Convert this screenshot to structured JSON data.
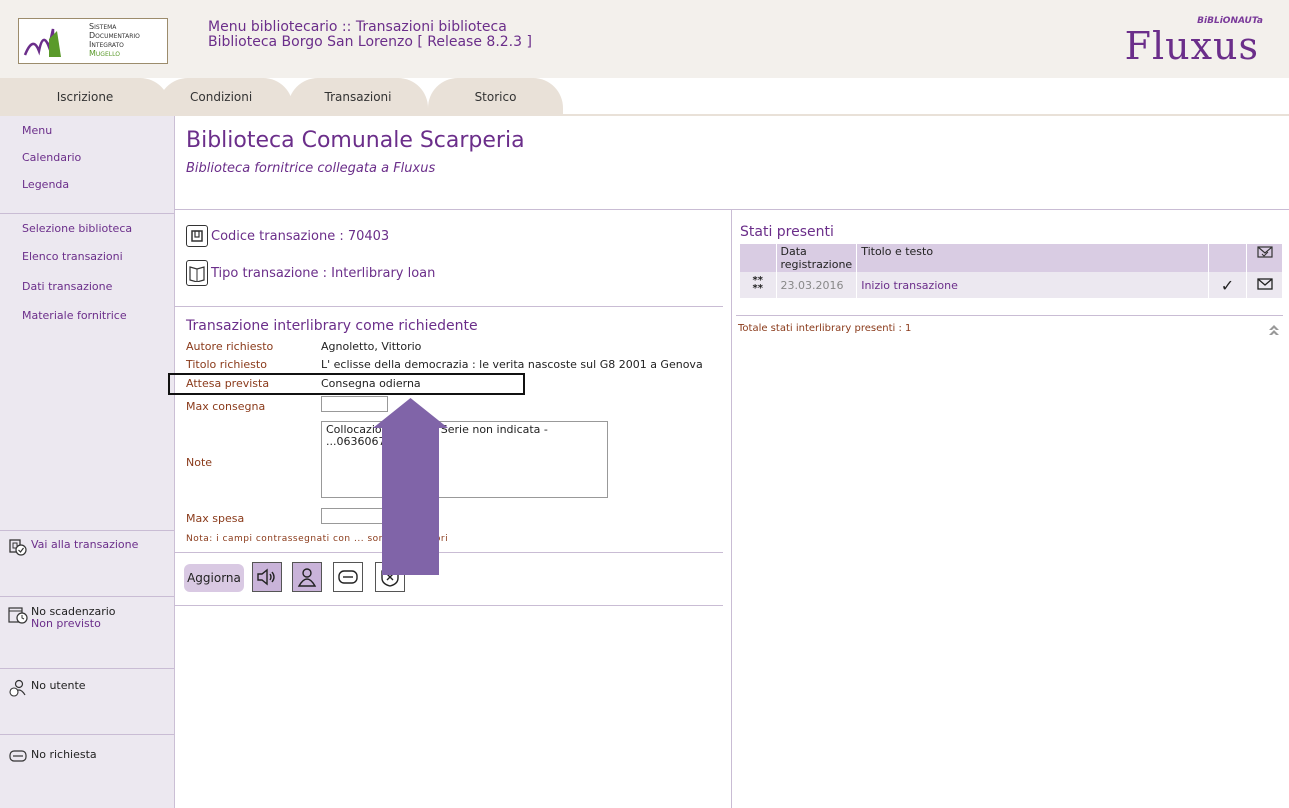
{
  "header": {
    "logo_lines": [
      "Sistema",
      "Documentario",
      "Integrato",
      "Mugello"
    ],
    "title_line1": "Menu bibliotecario :: Transazioni biblioteca",
    "title_line2": "Biblioteca Borgo San Lorenzo [ Release 8.2.3 ]",
    "brand": "Fluxus",
    "brand_tag": "BiBLiONAUTa"
  },
  "tabs": [
    "Iscrizione",
    "Condizioni",
    "Transazioni",
    "Storico"
  ],
  "sidebar": {
    "top_links": [
      "Menu",
      "Calendario",
      "Legenda"
    ],
    "nav_links": [
      "Selezione biblioteca",
      "Elenco transazioni",
      "Dati transazione",
      "Materiale fornitrice"
    ],
    "goto_transaction": "Vai alla transazione",
    "schedule": "No scadenzario",
    "schedule_sub": "Non previsto",
    "user": "No utente",
    "request": "No richiesta"
  },
  "main": {
    "library_title": "Biblioteca Comunale Scarperia",
    "library_subtitle": "Biblioteca fornitrice collegata a Fluxus",
    "codice": "Codice transazione : 70403",
    "tipo": "Tipo transazione : Interlibrary loan",
    "section_title": "Transazione interlibrary come richiedente",
    "fields": [
      {
        "label": "Autore richiesto",
        "value": "Agnoletto, Vittorio"
      },
      {
        "label": "Titolo richiesto",
        "value": "L' eclisse della democrazia : le verita nascoste sul G8 2001 a Genova"
      },
      {
        "label": "Attesa prevista",
        "value": "Consegna odierna"
      }
    ],
    "max_consegna_label": "Max consegna",
    "note_label": "Note",
    "note_value": "Collocazione: ...GN - Serie non indicata - ...0636067",
    "max_spesa_label": "Max spesa",
    "required_note": "Nota: i campi contrassegnati con ... sono obbligatori",
    "update_button": "Aggiorna"
  },
  "stati": {
    "title": "Stati presenti",
    "columns": [
      "",
      "Data registrazione",
      "Titolo e testo",
      "",
      ""
    ],
    "rows": [
      {
        "marker": "**",
        "date": "23.03.2016",
        "title": "Inizio transazione"
      }
    ],
    "total": "Totale stati interlibrary presenti : 1"
  },
  "colors": {
    "accent": "#6b2e8a",
    "arrow": "#8064a8",
    "tab_bg": "#e9e1d8",
    "sidebar_bg": "#ece8f0"
  }
}
